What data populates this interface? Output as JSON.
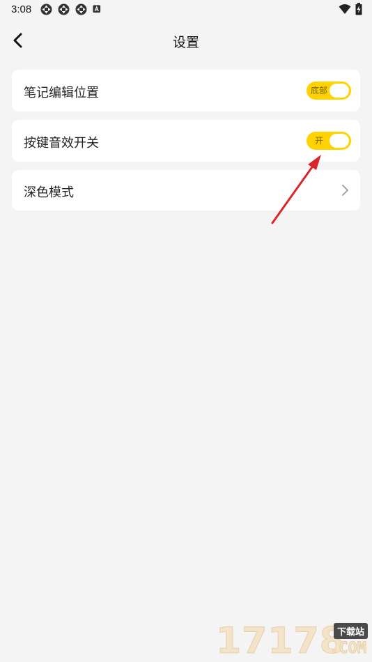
{
  "status_bar": {
    "time": "3:08",
    "left_icons": [
      "notification-icon",
      "notification-icon",
      "notification-icon",
      "app-a-icon"
    ],
    "right_icons": [
      "wifi-icon",
      "battery-charging-icon"
    ]
  },
  "header": {
    "title": "设置",
    "back_icon": "chevron-left-icon"
  },
  "settings": [
    {
      "label": "笔记编辑位置",
      "control": "toggle",
      "toggle_text": "底部",
      "on": true
    },
    {
      "label": "按键音效开关",
      "control": "toggle",
      "toggle_text": "开",
      "on": true
    },
    {
      "label": "深色模式",
      "control": "chevron",
      "icon": "chevron-right-icon"
    }
  ],
  "colors": {
    "background": "#f4f4f4",
    "card": "#ffffff",
    "accent": "#ffd200",
    "annotation_arrow": "#d9262b"
  },
  "watermark": {
    "digits": "17178",
    "badge": "下载站",
    "suffix": ".COM"
  }
}
